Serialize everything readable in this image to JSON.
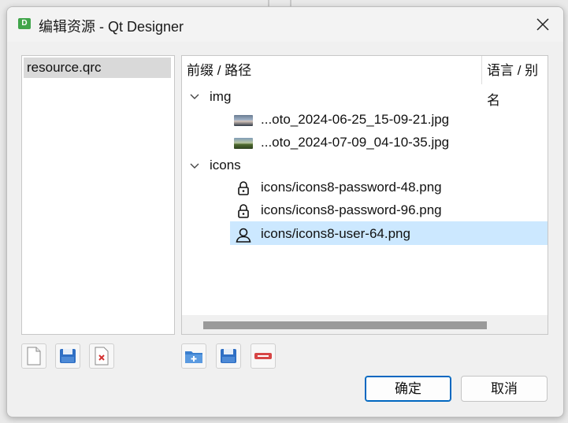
{
  "window": {
    "title": "编辑资源 - Qt Designer",
    "app_icon_letter": "D"
  },
  "file_list": {
    "items": [
      "resource.qrc"
    ],
    "selected": "resource.qrc"
  },
  "tree": {
    "columns": [
      "前缀 / 路径",
      "语言 / 别名"
    ],
    "groups": [
      {
        "name": "img",
        "expanded": true,
        "items": [
          {
            "label": "...oto_2024-06-25_15-09-21.jpg",
            "icon": "photo-thumbnail-icon"
          },
          {
            "label": "...oto_2024-07-09_04-10-35.jpg",
            "icon": "photo-thumbnail-icon"
          }
        ]
      },
      {
        "name": "icons",
        "expanded": true,
        "items": [
          {
            "label": "icons/icons8-password-48.png",
            "icon": "lock-icon"
          },
          {
            "label": "icons/icons8-password-96.png",
            "icon": "lock-icon"
          },
          {
            "label": "icons/icons8-user-64.png",
            "icon": "user-icon",
            "selected": true
          }
        ]
      }
    ]
  },
  "left_toolbar": [
    "new-file-icon",
    "save-icon",
    "remove-file-icon"
  ],
  "right_toolbar": [
    "add-prefix-icon",
    "add-files-icon",
    "remove-icon"
  ],
  "buttons": {
    "ok": "确定",
    "cancel": "取消"
  },
  "colors": {
    "selection": "#cce8ff",
    "primary_border": "#0067c0"
  }
}
